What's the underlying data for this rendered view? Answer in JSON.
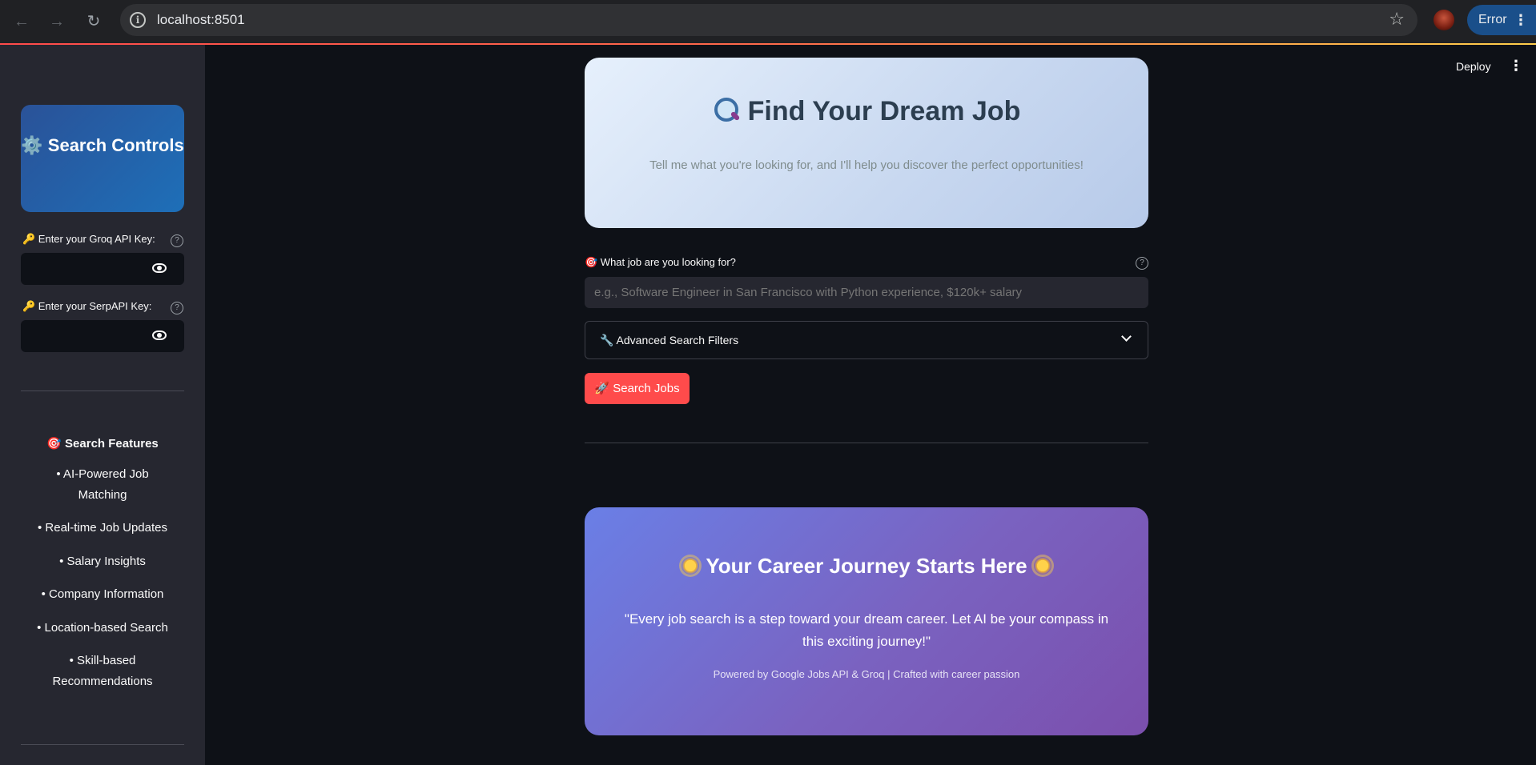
{
  "browser": {
    "url": "localhost:8501",
    "profile_status": "Error"
  },
  "sidebar": {
    "card_title": "⚙️ Search Controls",
    "groq_label": "🔑 Enter your Groq API Key:",
    "serp_label": "🔑 Enter your SerpAPI Key:",
    "features_title": "🎯 Search Features",
    "features": [
      "• AI-Powered Job Matching",
      "• Real-time Job Updates",
      "• Salary Insights",
      "• Company Information",
      "• Location-based Search",
      "• Skill-based Recommendations"
    ]
  },
  "header": {
    "deploy_label": "Deploy"
  },
  "hero": {
    "title": "Find Your Dream Job",
    "subtitle": "Tell me what you're looking for, and I'll help you discover the perfect opportunities!"
  },
  "query": {
    "label": "🎯 What job are you looking for?",
    "placeholder": "e.g., Software Engineer in San Francisco with Python experience, $120k+ salary"
  },
  "filters": {
    "label": "🔧 Advanced Search Filters"
  },
  "search_button": "🚀 Search Jobs",
  "journey": {
    "title": "Your Career Journey Starts Here",
    "quote": "\"Every job search is a step toward your dream career. Let AI be your compass in this exciting journey!\"",
    "footer": "Powered by Google Jobs API & Groq | Crafted with career passion"
  }
}
